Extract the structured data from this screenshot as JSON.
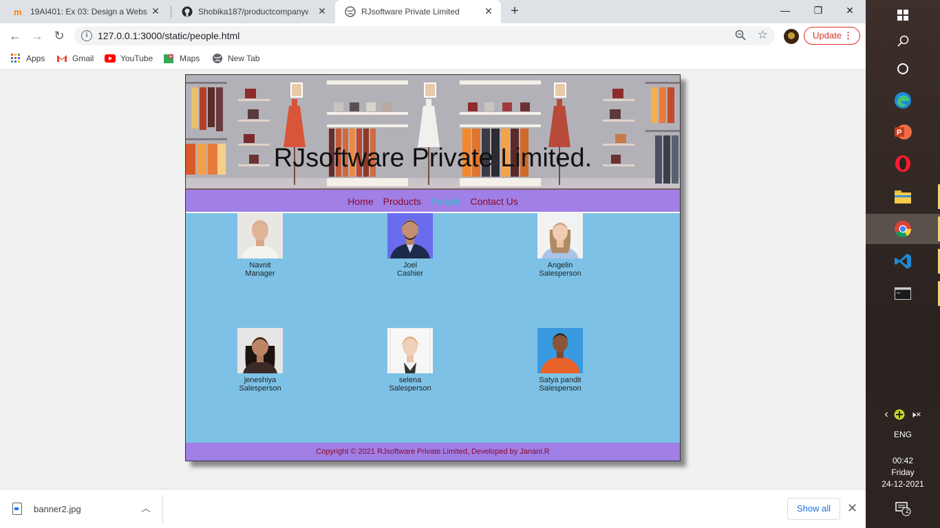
{
  "browser": {
    "tabs": [
      {
        "title": "19AI401: Ex 03: Design a Website",
        "icon": "moodle-icon"
      },
      {
        "title": "Shobika187/productcompanywebsite",
        "icon": "github-icon"
      },
      {
        "title": "RJsoftware Private Limited",
        "icon": "globe-icon"
      }
    ],
    "url": "127.0.0.1:3000/static/people.html",
    "update_label": "Update",
    "bookmarks": [
      {
        "label": "Apps"
      },
      {
        "label": "Gmail"
      },
      {
        "label": "YouTube"
      },
      {
        "label": "Maps"
      },
      {
        "label": "New Tab"
      }
    ]
  },
  "site": {
    "title": "RJsoftware Private Limited.",
    "nav": [
      "Home",
      "Products",
      "People",
      "Contact Us"
    ],
    "current_nav": "People",
    "people": [
      {
        "name": "Navnit",
        "role": "Manager"
      },
      {
        "name": "Joel",
        "role": "Cashier"
      },
      {
        "name": "Angelin",
        "role": "Salesperson"
      },
      {
        "name": "jeneshiya",
        "role": "Salesperson"
      },
      {
        "name": "selena",
        "role": "Salesperson"
      },
      {
        "name": "Satya pandit",
        "role": "Salesperson"
      }
    ],
    "footer": "Copyright © 2021 RJsoftware Private Limited, Developed by Janani.R"
  },
  "downloads": {
    "file": "banner2.jpg",
    "show_all": "Show all"
  },
  "taskbar": {
    "language": "ENG",
    "time": "00:42",
    "day": "Friday",
    "date": "24-12-2021",
    "notification_count": "2"
  },
  "colors": {
    "nav_bg": "#a07fe6",
    "people_bg": "#7dc2e6",
    "link": "#8b0a2a",
    "current_link": "#2fc0c8"
  }
}
